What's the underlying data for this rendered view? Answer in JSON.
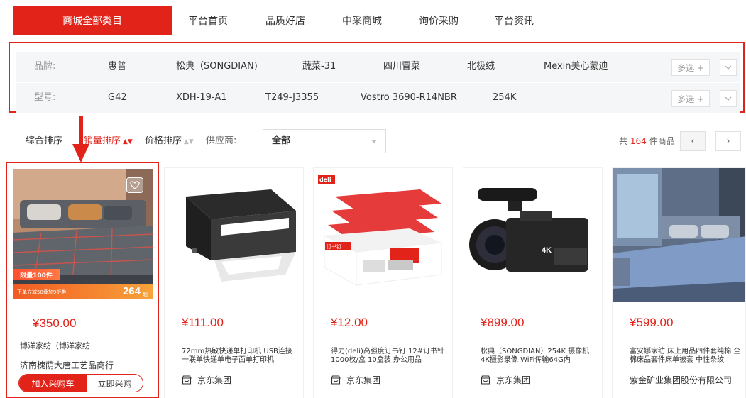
{
  "nav": {
    "active_tab": "商城全部类目",
    "tabs": [
      "平台首页",
      "品质好店",
      "中采商城",
      "询价采购",
      "平台资讯"
    ]
  },
  "filters": {
    "brand": {
      "label": "品牌:",
      "items": [
        "惠普",
        "松典（SONGDIAN)",
        "蔬菜-31",
        "四川冒菜",
        "北极绒",
        "Mexin美心蒙迪"
      ],
      "multi_label": "多选 +"
    },
    "model": {
      "label": "型号:",
      "items": [
        "G42",
        "XDH-19-A1",
        "T249-J3355",
        "Vostro 3690-R14NBR",
        "254K"
      ],
      "multi_label": "多选 +"
    }
  },
  "sort": {
    "comprehensive": "综合排序",
    "sales": "销量排序",
    "price": "价格排序",
    "supplier_label": "供应商:",
    "supplier_value": "全部",
    "total_prefix": "共",
    "total_count": "164",
    "total_suffix": "件商品",
    "prev": "‹",
    "next": "›"
  },
  "products": [
    {
      "price": "¥350.00",
      "title": "博洋家纺（博洋家纺",
      "shop": "济南槐荫大唐工艺品商行",
      "promo_tag": "限量100件",
      "promo_text": "下单立减50叠加9折券",
      "promo_price": "264",
      "promo_unit": "起",
      "add_cart": "加入采购车",
      "buy_now": "立即采购"
    },
    {
      "price": "¥111.00",
      "title": "72mm热敏快递单打印机 USB连接一联单快递单电子面单打印机",
      "shop": "京东集团"
    },
    {
      "price": "¥12.00",
      "title": "得力(deli)高强度订书钉 12#订书针 1000枚/盒 10盒装 办公用品",
      "shop": "京东集团",
      "brand_mark": "deli",
      "box_text": "订书钉"
    },
    {
      "price": "¥899.00",
      "title": "松典（SONGDIAN）254K 摄像机4K摄影录像 WiFi传输64G内",
      "shop": "京东集团",
      "badge": "4K"
    },
    {
      "price": "¥599.00",
      "title": "富安娜家纺 床上用品四件套纯棉 全棉床品套件床单被套 中性条纹",
      "shop": "紫金矿业集团股份有限公司"
    }
  ],
  "colors": {
    "brand_red": "#e2231a",
    "panel_bg": "#f5f6f7"
  }
}
